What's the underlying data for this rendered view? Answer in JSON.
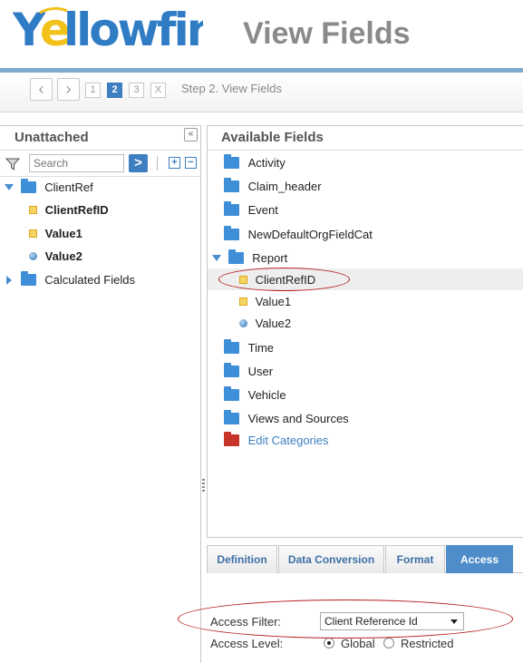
{
  "app": {
    "logo_text": "Yellowfin",
    "page_title": "View Fields"
  },
  "wizard": {
    "back_icon": "chevron-left-icon",
    "forward_icon": "chevron-right-icon",
    "steps": [
      "1",
      "2",
      "3",
      "X"
    ],
    "active_step": "2",
    "step_label": "Step 2. View Fields"
  },
  "left_panel": {
    "title": "Unattached",
    "search_placeholder": "Search",
    "go_label": ">",
    "expand_all": "+",
    "collapse_all": "−",
    "tree": {
      "client_ref": "ClientRef",
      "client_ref_id": "ClientRefID",
      "value1": "Value1",
      "value2": "Value2",
      "calculated_fields": "Calculated Fields"
    }
  },
  "right_panel": {
    "title": "Available Fields",
    "folders": {
      "activity": "Activity",
      "claim_header": "Claim_header",
      "event": "Event",
      "new_default": "NewDefaultOrgFieldCat",
      "report": "Report",
      "time": "Time",
      "user": "User",
      "vehicle": "Vehicle",
      "views_sources": "Views and Sources",
      "edit_categories": "Edit Categories"
    },
    "report_children": {
      "client_ref_id": "ClientRefID",
      "value1": "Value1",
      "value2": "Value2"
    }
  },
  "tabs": {
    "definition": "Definition",
    "data_conversion": "Data Conversion",
    "format": "Format",
    "access": "Access",
    "active": "Access"
  },
  "access": {
    "filter_label": "Access Filter:",
    "filter_value": "Client Reference Id",
    "level_label": "Access Level:",
    "global_label": "Global",
    "restricted_label": "Restricted",
    "selected_level": "Global"
  },
  "colors": {
    "brand_blue": "#3d7fc0",
    "highlight_ellipse": "#b41f1f"
  }
}
